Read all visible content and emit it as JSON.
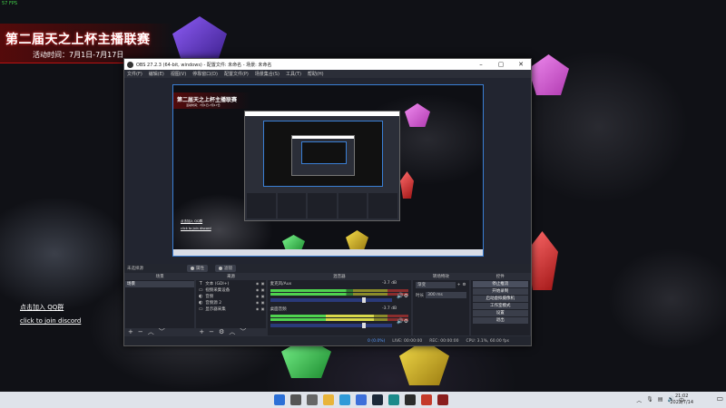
{
  "desktop": {
    "fps": "57 FPS",
    "banner_title": "第二届天之上杯主播联赛",
    "banner_date": "活动时间：7月1日-7月17日",
    "link_qq": "点击加入 QQ群",
    "link_discord": "click to join discord"
  },
  "obs": {
    "window_title": "OBS 27.2.3 (64-bit, windows) - 配置文件: 未命名 - 场景: 未命名",
    "menu": [
      "文件(F)",
      "编辑(E)",
      "视图(V)",
      "停靠窗口(D)",
      "配置文件(P)",
      "场景集合(S)",
      "工具(T)",
      "帮助(H)"
    ],
    "scene_label": "未选择源",
    "tab_properties": "属性",
    "tab_filters": "滤镜",
    "docks": {
      "scenes": "场景",
      "sources": "来源",
      "mixer": "混音器",
      "transitions": "转场特效",
      "controls": "控件"
    },
    "scenes": [
      "场景"
    ],
    "sources": [
      {
        "icon": "T",
        "name": "文本 (GDI+)"
      },
      {
        "icon": "▭",
        "name": "视频采集设备"
      },
      {
        "icon": "◐",
        "name": "音频"
      },
      {
        "icon": "◐",
        "name": "音频源 2"
      },
      {
        "icon": "▭",
        "name": "显示器采集"
      }
    ],
    "mixer": [
      {
        "name": "麦克风/Aux",
        "db": "-3.7 dB",
        "level": 0.75
      },
      {
        "name": "桌面音频",
        "db": "-3.7 dB",
        "level": 0.75
      }
    ],
    "transition": {
      "type": "渐变",
      "duration_label": "时长",
      "duration": "300 ms"
    },
    "controls": [
      "停止推流",
      "开始录制",
      "启动虚拟摄像机",
      "工作室模式",
      "设置",
      "退出"
    ],
    "status": {
      "live_label": "LIVE:",
      "live_time": "00:00:00",
      "rec_label": "REC:",
      "rec_time": "00:00:00",
      "cpu": "CPU: 3.1%, 60.00 fps",
      "dropped": "0 (0.0%)"
    },
    "preview_banner_title": "第二届天之上杯主播联赛",
    "preview_banner_date": "活动时间：7月1日-7月17日",
    "preview_link_qq": "点击加入 QQ群",
    "preview_link_discord": "click to join discord"
  },
  "taskbar": {
    "time": "21:02",
    "date": "2022/7/14",
    "lang": "中",
    "apps": [
      {
        "name": "windows-icon",
        "color": "#2b6fd6"
      },
      {
        "name": "search-icon",
        "color": "#555555"
      },
      {
        "name": "task-view-icon",
        "color": "#666666"
      },
      {
        "name": "file-explorer-icon",
        "color": "#e8b43a"
      },
      {
        "name": "edge-icon",
        "color": "#2f9ad8"
      },
      {
        "name": "store-icon",
        "color": "#3d6fd9"
      },
      {
        "name": "steam-icon",
        "color": "#1b2838"
      },
      {
        "name": "app-icon",
        "color": "#1b8a8a"
      },
      {
        "name": "obs-icon",
        "color": "#2b2b2b"
      },
      {
        "name": "game-icon",
        "color": "#c43a2a"
      },
      {
        "name": "app2-icon",
        "color": "#8a1e1e"
      }
    ]
  }
}
